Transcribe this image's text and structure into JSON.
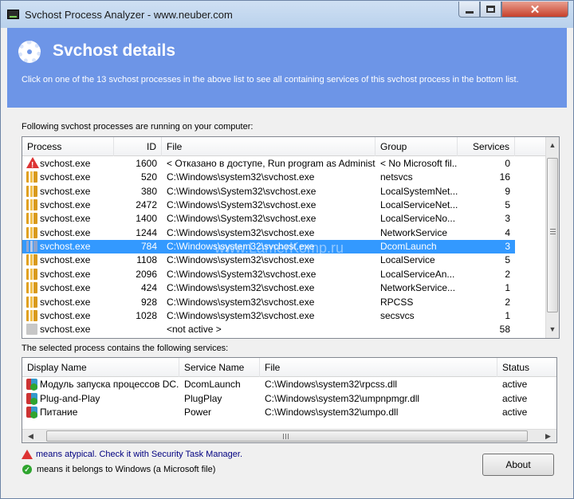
{
  "window": {
    "title": "Svchost Process Analyzer - www.neuber.com",
    "close_glyph": "✕"
  },
  "header": {
    "title": "Svchost details",
    "description": "Click on one of the 13 svchost processes in the above list to see all containing services of this svchost process in the bottom list."
  },
  "processes": {
    "label": "Following svchost processes are running on your computer:",
    "columns": [
      "Process",
      "ID",
      "File",
      "Group",
      "Services"
    ],
    "rows": [
      {
        "icon": "warning-icon",
        "process": "svchost.exe",
        "id": "1600",
        "file": "< Отказано в доступе, Run program as Administr...",
        "group": "< No Microsoft fil...",
        "services": "0"
      },
      {
        "icon": "folder-icon",
        "process": "svchost.exe",
        "id": "520",
        "file": "C:\\Windows\\system32\\svchost.exe",
        "group": "netsvcs",
        "services": "16"
      },
      {
        "icon": "folder-icon",
        "process": "svchost.exe",
        "id": "380",
        "file": "C:\\Windows\\System32\\svchost.exe",
        "group": "LocalSystemNet...",
        "services": "9"
      },
      {
        "icon": "folder-icon",
        "process": "svchost.exe",
        "id": "2472",
        "file": "C:\\Windows\\System32\\svchost.exe",
        "group": "LocalServiceNet...",
        "services": "5"
      },
      {
        "icon": "folder-icon",
        "process": "svchost.exe",
        "id": "1400",
        "file": "C:\\Windows\\System32\\svchost.exe",
        "group": "LocalServiceNo...",
        "services": "3"
      },
      {
        "icon": "folder-icon",
        "process": "svchost.exe",
        "id": "1244",
        "file": "C:\\Windows\\system32\\svchost.exe",
        "group": "NetworkService",
        "services": "4"
      },
      {
        "icon": "folder-icon",
        "process": "svchost.exe",
        "id": "784",
        "file": "C:\\Windows\\system32\\svchost.exe",
        "group": "DcomLaunch",
        "services": "3",
        "selected": true
      },
      {
        "icon": "folder-icon",
        "process": "svchost.exe",
        "id": "1108",
        "file": "C:\\Windows\\system32\\svchost.exe",
        "group": "LocalService",
        "services": "5"
      },
      {
        "icon": "folder-icon",
        "process": "svchost.exe",
        "id": "2096",
        "file": "C:\\Windows\\System32\\svchost.exe",
        "group": "LocalServiceAn...",
        "services": "2"
      },
      {
        "icon": "folder-icon",
        "process": "svchost.exe",
        "id": "424",
        "file": "C:\\Windows\\system32\\svchost.exe",
        "group": "NetworkService...",
        "services": "1"
      },
      {
        "icon": "folder-icon",
        "process": "svchost.exe",
        "id": "928",
        "file": "C:\\Windows\\system32\\svchost.exe",
        "group": "RPCSS",
        "services": "2"
      },
      {
        "icon": "folder-icon",
        "process": "svchost.exe",
        "id": "1028",
        "file": "C:\\Windows\\system32\\svchost.exe",
        "group": "secsvcs",
        "services": "1"
      },
      {
        "icon": "blank-icon",
        "process": "svchost.exe",
        "id": "",
        "file": "<not active >",
        "group": "",
        "services": "58"
      }
    ]
  },
  "services": {
    "label": "The selected process contains the following services:",
    "columns": [
      "Display Name",
      "Service Name",
      "File",
      "Status"
    ],
    "rows": [
      {
        "display_name": "Модуль запуска процессов DC...",
        "service_name": "DcomLaunch",
        "file": "C:\\Windows\\system32\\rpcss.dll",
        "status": "active"
      },
      {
        "display_name": "Plug-and-Play",
        "service_name": "PlugPlay",
        "file": "C:\\Windows\\system32\\umpnpmgr.dll",
        "status": "active"
      },
      {
        "display_name": "Питание",
        "service_name": "Power",
        "file": "C:\\Windows\\system32\\umpo.dll",
        "status": "active"
      }
    ]
  },
  "legend": {
    "atypical": "means atypical. Check it with Security Task Manager.",
    "windows": "means it belongs to Windows (a Microsoft file)"
  },
  "buttons": {
    "about": "About"
  },
  "watermark": "www.LamerKomp.ru",
  "colors": {
    "header_bg": "#6d95e7",
    "selection": "#3399ff",
    "atypical_link": "#000080"
  }
}
